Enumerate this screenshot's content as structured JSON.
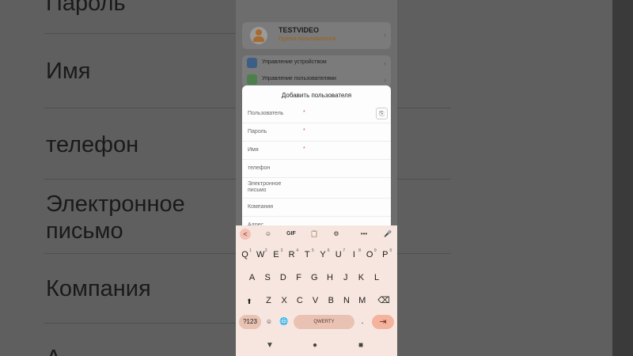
{
  "background": {
    "left_labels": [
      "Пароль",
      "Имя",
      "телефон",
      "Электронное\nписьмо",
      "Компания",
      "А"
    ]
  },
  "user_card": {
    "name": "TESTVIDEO",
    "group": "Группа пользователей",
    "avatar_icon": "user-avatar-icon"
  },
  "menu": {
    "items": [
      {
        "label": "Управление устройством",
        "icon": "cube-icon",
        "color": "#3d5f86"
      },
      {
        "label": "Управление пользователями",
        "icon": "users-icon",
        "color": "#4c7f4c"
      }
    ]
  },
  "dialog": {
    "title": "Добавить пользователя",
    "fields": [
      {
        "label": "Пользователь",
        "required": "*"
      },
      {
        "label": "Пароль",
        "required": "*"
      },
      {
        "label": "Имя",
        "required": "*"
      },
      {
        "label": "телефон",
        "required": ""
      },
      {
        "label": "Электронное\nписьмо",
        "required": ""
      },
      {
        "label": "Компания",
        "required": ""
      },
      {
        "label": "Адрес",
        "required": ""
      }
    ]
  },
  "keyboard": {
    "toolbar": [
      "<",
      "☺",
      "GIF",
      "📋",
      "⚙",
      "•••",
      "🎤"
    ],
    "row1": [
      "Q",
      "W",
      "E",
      "R",
      "T",
      "Y",
      "U",
      "I",
      "O",
      "P"
    ],
    "row1_hints": [
      "1",
      "2",
      "3",
      "4",
      "5",
      "6",
      "7",
      "8",
      "9",
      "0"
    ],
    "row2": [
      "A",
      "S",
      "D",
      "F",
      "G",
      "H",
      "J",
      "K",
      "L"
    ],
    "row3": [
      "Z",
      "X",
      "C",
      "V",
      "B",
      "N",
      "M"
    ],
    "shift": "⬆",
    "backspace": "⌫",
    "numbers": "?123",
    "emoji": "☺",
    "globe": "🌐",
    "space": "QWERTY",
    "period": ".",
    "enter": "⇥",
    "accent": "#f4b39e"
  },
  "navbar": {
    "back": "▼",
    "home": "●",
    "recents": "■"
  }
}
